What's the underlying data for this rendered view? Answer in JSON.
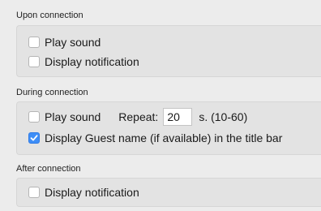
{
  "sections": {
    "upon": {
      "title": "Upon connection",
      "play_sound": {
        "label": "Play sound",
        "checked": false
      },
      "display_notification": {
        "label": "Display notification",
        "checked": false
      }
    },
    "during": {
      "title": "During connection",
      "play_sound": {
        "label": "Play sound",
        "checked": false
      },
      "repeat_label": "Repeat:",
      "repeat_value": "20",
      "repeat_units": "s. (10-60)",
      "display_guest_name": {
        "label": "Display Guest name (if available) in the title bar",
        "checked": true
      }
    },
    "after": {
      "title": "After connection",
      "display_notification": {
        "label": "Display notification",
        "checked": false
      }
    }
  },
  "colors": {
    "checkbox_checked": "#3e8ef7"
  }
}
